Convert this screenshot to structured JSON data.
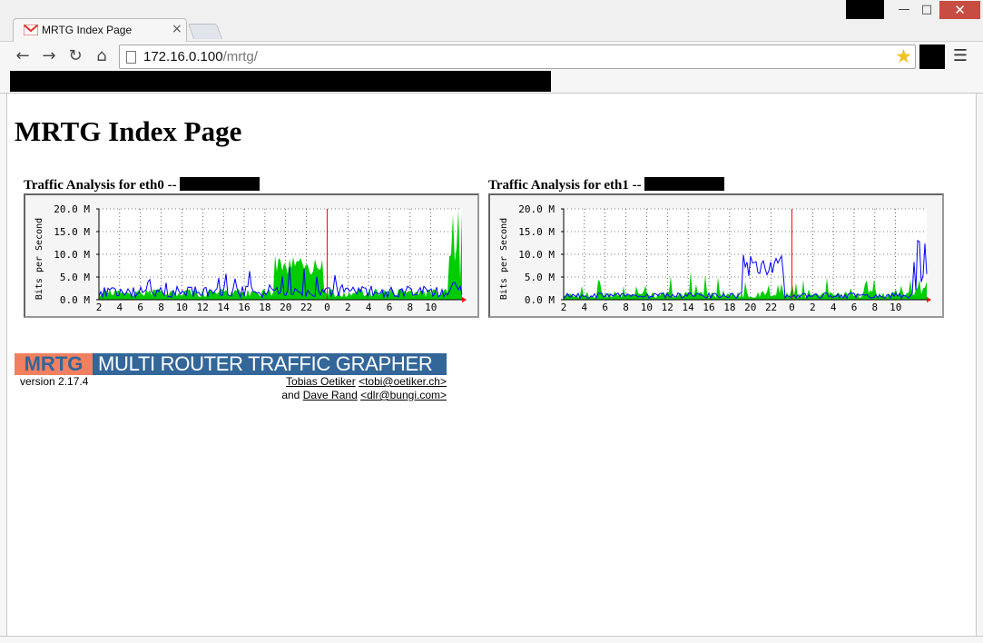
{
  "browser": {
    "tab_title": "MRTG Index Page",
    "tab_close": "×",
    "url_host": "172.16.0.100",
    "url_path": "/mrtg/",
    "window_controls": {
      "minimize": "—",
      "maximize": "□",
      "close": "✕"
    }
  },
  "page": {
    "title": "MRTG Index Page"
  },
  "graphs": [
    {
      "heading": "Traffic Analysis for eth0 --",
      "ylabel": "Bits per Second",
      "yticks": [
        "20.0 M",
        "15.0 M",
        "10.0 M",
        "5.0 M",
        "0.0 M"
      ],
      "xticks": [
        "2",
        "4",
        "6",
        "8",
        "10",
        "12",
        "14",
        "16",
        "18",
        "20",
        "22",
        "0",
        "2",
        "4",
        "6",
        "8",
        "10"
      ]
    },
    {
      "heading": "Traffic Analysis for eth1 --",
      "ylabel": "Bits per Second",
      "yticks": [
        "20.0 M",
        "15.0 M",
        "10.0 M",
        "5.0 M",
        "0.0 M"
      ],
      "xticks": [
        "2",
        "4",
        "6",
        "8",
        "10",
        "12",
        "14",
        "16",
        "18",
        "20",
        "22",
        "0",
        "2",
        "4",
        "6",
        "8",
        "10"
      ]
    }
  ],
  "footer": {
    "logo_mrtg": "MRTG",
    "logo_full": "MULTI ROUTER TRAFFIC GRAPHER",
    "version": "version 2.17.4",
    "author1_name": "Tobias Oetiker",
    "author1_email": "<tobi@oetiker.ch>",
    "and": "and",
    "author2_name": "Dave Rand",
    "author2_email": "<dlr@bungi.com>"
  },
  "colors": {
    "in_traffic": "#00cc00",
    "out_traffic": "#0000ff",
    "now_marker": "#ff0000",
    "logo_orange": "#f08060",
    "logo_blue": "#336699"
  },
  "icons": [
    "gmail-favicon",
    "back-arrow-icon",
    "forward-arrow-icon",
    "reload-icon",
    "home-icon",
    "page-icon",
    "bookmark-star-icon",
    "menu-icon"
  ]
}
